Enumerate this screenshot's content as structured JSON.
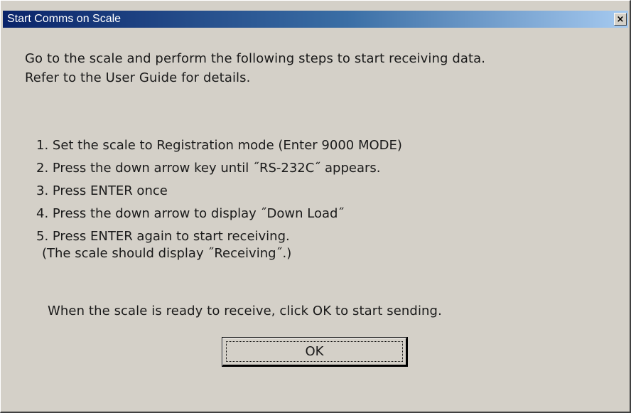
{
  "window": {
    "title": "Start Comms on Scale",
    "close_icon": "×"
  },
  "intro": {
    "line1": "Go to the scale and perform the following steps to start receiving data.",
    "line2": "Refer to the User Guide for details."
  },
  "steps": [
    "1. Set the scale to Registration mode (Enter 9000 MODE)",
    "2. Press the down arrow key until ˝RS-232C˝ appears.",
    "3. Press ENTER once",
    "4. Press the down arrow to display ˝Down Load˝",
    "5. Press ENTER again to start receiving."
  ],
  "step5_note": "(The scale should display ˝Receiving˝.)",
  "ready_text": "When the scale is ready to receive, click OK to start sending.",
  "ok_label": "OK",
  "colors": {
    "dialog_face": "#d4d0c8",
    "title_start": "#0a246a",
    "title_end": "#a6caf0"
  }
}
